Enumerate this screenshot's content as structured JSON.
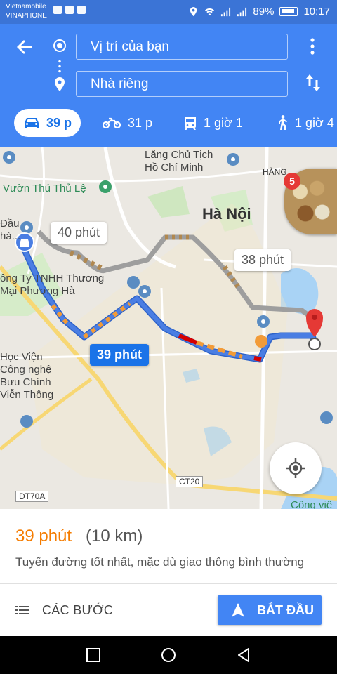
{
  "status_bar": {
    "carrier_line1": "Vietnamobile",
    "carrier_line2": "VINAPHONE",
    "battery": "89%",
    "time": "10:17"
  },
  "header": {
    "origin": "Vị trí của bạn",
    "destination": "Nhà riêng",
    "icons": [
      "back-arrow-icon",
      "origin-dot-icon",
      "destination-pin-icon",
      "more-vert-icon",
      "swap-icon"
    ]
  },
  "modes": [
    {
      "icon": "car-icon",
      "label": "39 p",
      "active": true
    },
    {
      "icon": "motorbike-icon",
      "label": "31 p"
    },
    {
      "icon": "transit-icon",
      "label": "1 giờ 1"
    },
    {
      "icon": "walk-icon",
      "label": "1 giờ 4"
    }
  ],
  "map": {
    "labels": {
      "mausoleum": "Lăng Chủ Tịch\nHồ Chí Minh",
      "zoo": "Vườn Thú Thủ Lệ",
      "hanoi": "Hà Nội",
      "hang": "HÀNG",
      "dau": "Đầu\nhà...",
      "company": "ông Ty TNHH Thương\nMại Phương Hà",
      "academy": "Học Viện\nCông nghệ\nBưu Chính\nViễn Thông",
      "cong_vien": "Công viê",
      "road_ct20": "CT20",
      "road_dt70a": "DT70A"
    },
    "alternates": [
      "40 phút",
      "38 phút"
    ],
    "selected_route_label": "39 phút",
    "notification_count": "5"
  },
  "panel": {
    "eta": "39 phút",
    "distance": "(10 km)",
    "description": "Tuyến đường tốt nhất, mặc dù giao thông bình thường",
    "steps_label": "CÁC BƯỚC",
    "start_label": "BẮT ĐẦU"
  },
  "colors": {
    "header": "#4285f4",
    "route": "#4a7ee3",
    "alt_route": "#9e9e9e",
    "traffic_slow": "#f29b38",
    "traffic_jam": "#d50000",
    "eta": "#f57c00"
  }
}
